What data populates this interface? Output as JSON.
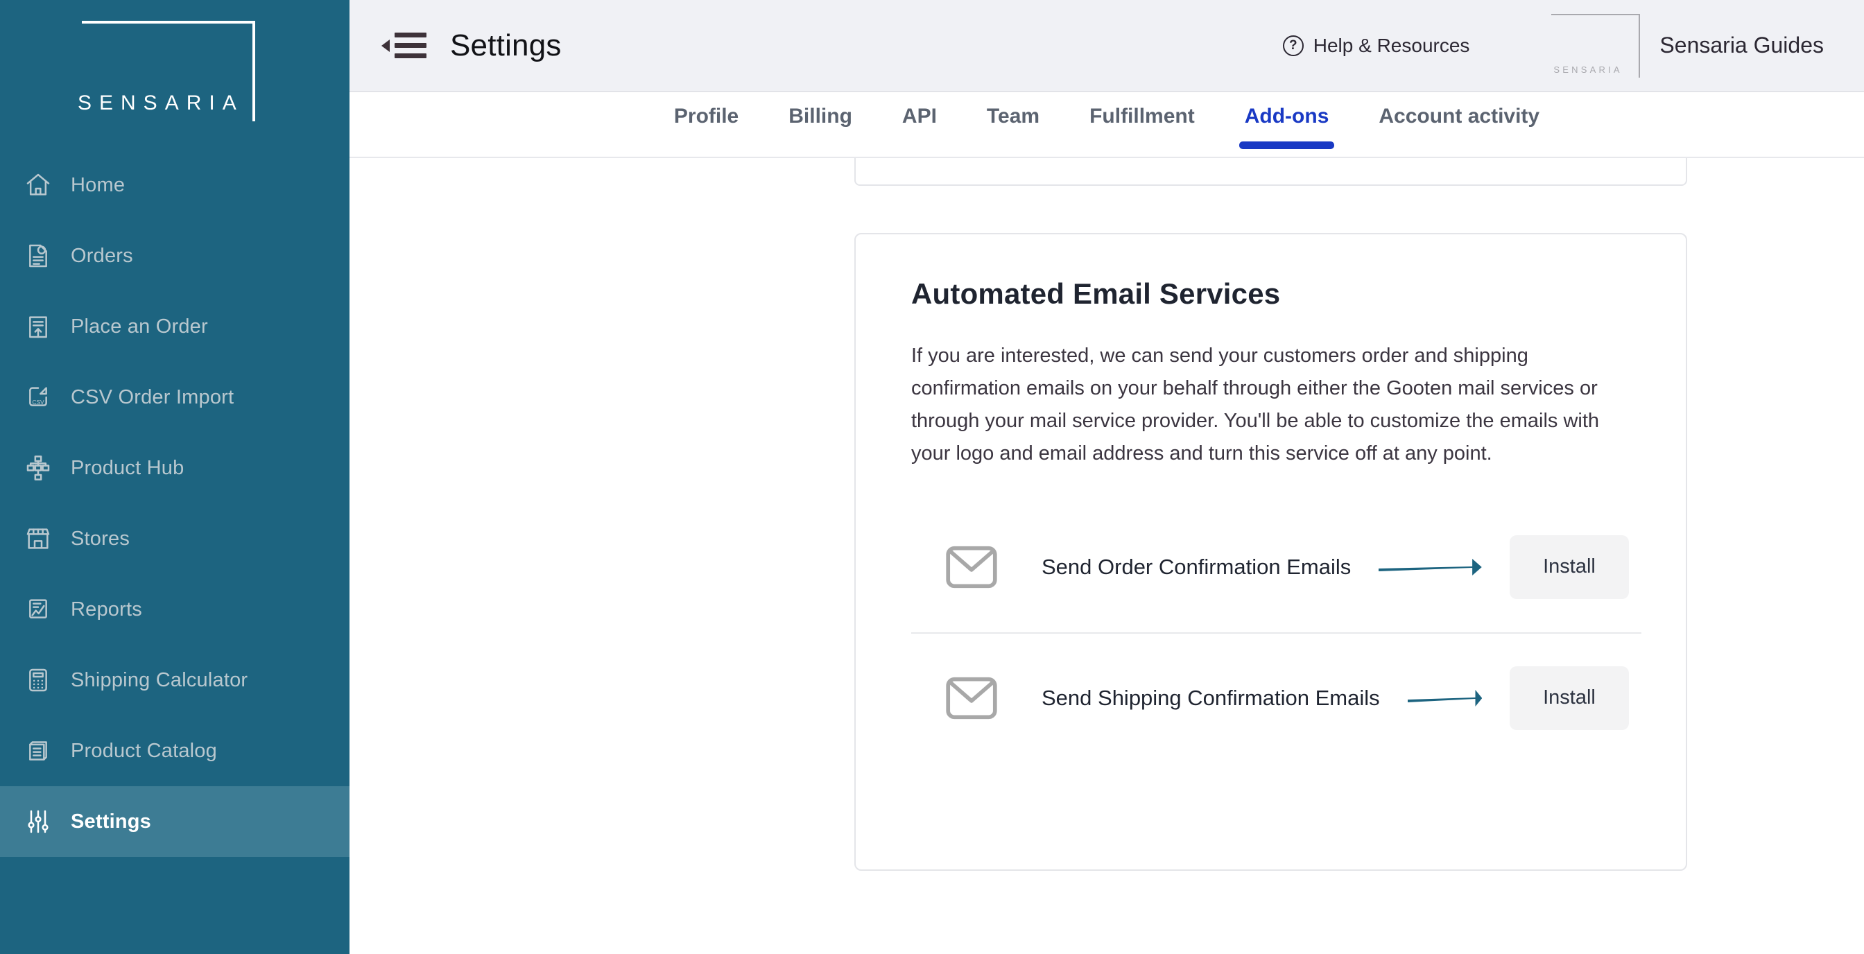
{
  "brand": {
    "name": "SENSARIA",
    "sidebar_bg": "#1d6480",
    "active_item_bg": "#3d7c94",
    "accent_blue": "#1939c4",
    "arrow_teal": "#1d6480"
  },
  "sidebar": {
    "logo_text": "SENSARIA",
    "items": [
      {
        "label": "Home",
        "icon": "home-icon",
        "active": false
      },
      {
        "label": "Orders",
        "icon": "orders-document-icon",
        "active": false
      },
      {
        "label": "Place an Order",
        "icon": "place-order-upload-icon",
        "active": false
      },
      {
        "label": "CSV Order Import",
        "icon": "csv-import-icon",
        "active": false
      },
      {
        "label": "Product Hub",
        "icon": "product-hub-hierarchy-icon",
        "active": false
      },
      {
        "label": "Stores",
        "icon": "storefront-icon",
        "active": false
      },
      {
        "label": "Reports",
        "icon": "reports-chart-icon",
        "active": false
      },
      {
        "label": "Shipping Calculator",
        "icon": "calculator-icon",
        "active": false
      },
      {
        "label": "Product Catalog",
        "icon": "catalog-book-icon",
        "active": false
      },
      {
        "label": "Settings",
        "icon": "sliders-icon",
        "active": true
      }
    ]
  },
  "header": {
    "menu_toggle_icon": "collapse-menu-icon",
    "title": "Settings",
    "help_label": "Help & Resources",
    "help_icon": "question-circle-icon",
    "help_glyph": "?",
    "guides_label": "Sensaria Guides",
    "guides_logo_text": "SENSARIA"
  },
  "tabs": [
    {
      "label": "Profile",
      "active": false
    },
    {
      "label": "Billing",
      "active": false
    },
    {
      "label": "API",
      "active": false
    },
    {
      "label": "Team",
      "active": false
    },
    {
      "label": "Fulfillment",
      "active": false
    },
    {
      "label": "Add-ons",
      "active": true
    },
    {
      "label": "Account activity",
      "active": false
    }
  ],
  "main": {
    "card": {
      "title": "Automated Email Services",
      "description": "If you are interested, we can send your customers order and shipping confirmation emails on your behalf through either the Gooten mail services or through your mail service provider. You'll be able to customize the emails with your logo and email address and turn this service off at any point.",
      "services": [
        {
          "icon": "envelope-icon",
          "label": "Send Order Confirmation Emails",
          "annotation": "arrow-right-annotation",
          "button_label": "Install"
        },
        {
          "icon": "envelope-icon",
          "label": "Send Shipping Confirmation Emails",
          "annotation": "arrow-right-annotation",
          "button_label": "Install"
        }
      ]
    }
  }
}
